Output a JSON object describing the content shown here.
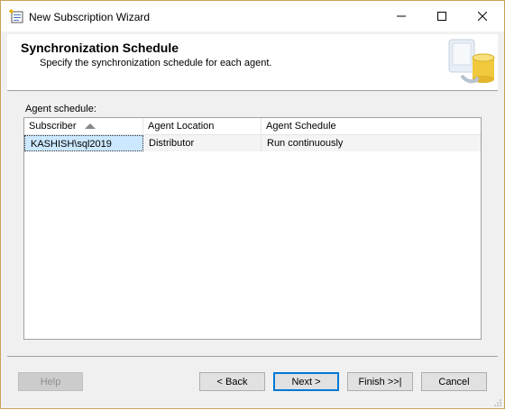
{
  "window": {
    "title": "New Subscription Wizard",
    "controls": {
      "minimize": "minimize-icon",
      "maximize": "maximize-icon",
      "close": "close-icon"
    }
  },
  "header": {
    "title": "Synchronization Schedule",
    "subtitle": "Specify the synchronization schedule for each agent."
  },
  "main": {
    "agent_schedule_label": "Agent schedule:",
    "table": {
      "columns": [
        "Subscriber",
        "Agent Location",
        "Agent Schedule"
      ],
      "sorted_column": "Subscriber",
      "rows": [
        {
          "subscriber": "KASHISH\\sql2019",
          "location": "Distributor",
          "schedule": "Run continuously"
        }
      ]
    }
  },
  "buttons": {
    "help": "Help",
    "back": "< Back",
    "next": "Next >",
    "finish": "Finish >>|",
    "cancel": "Cancel"
  },
  "colors": {
    "selection": "#cce8ff",
    "accent": "#0078d7",
    "window_border": "#c7a35a"
  }
}
